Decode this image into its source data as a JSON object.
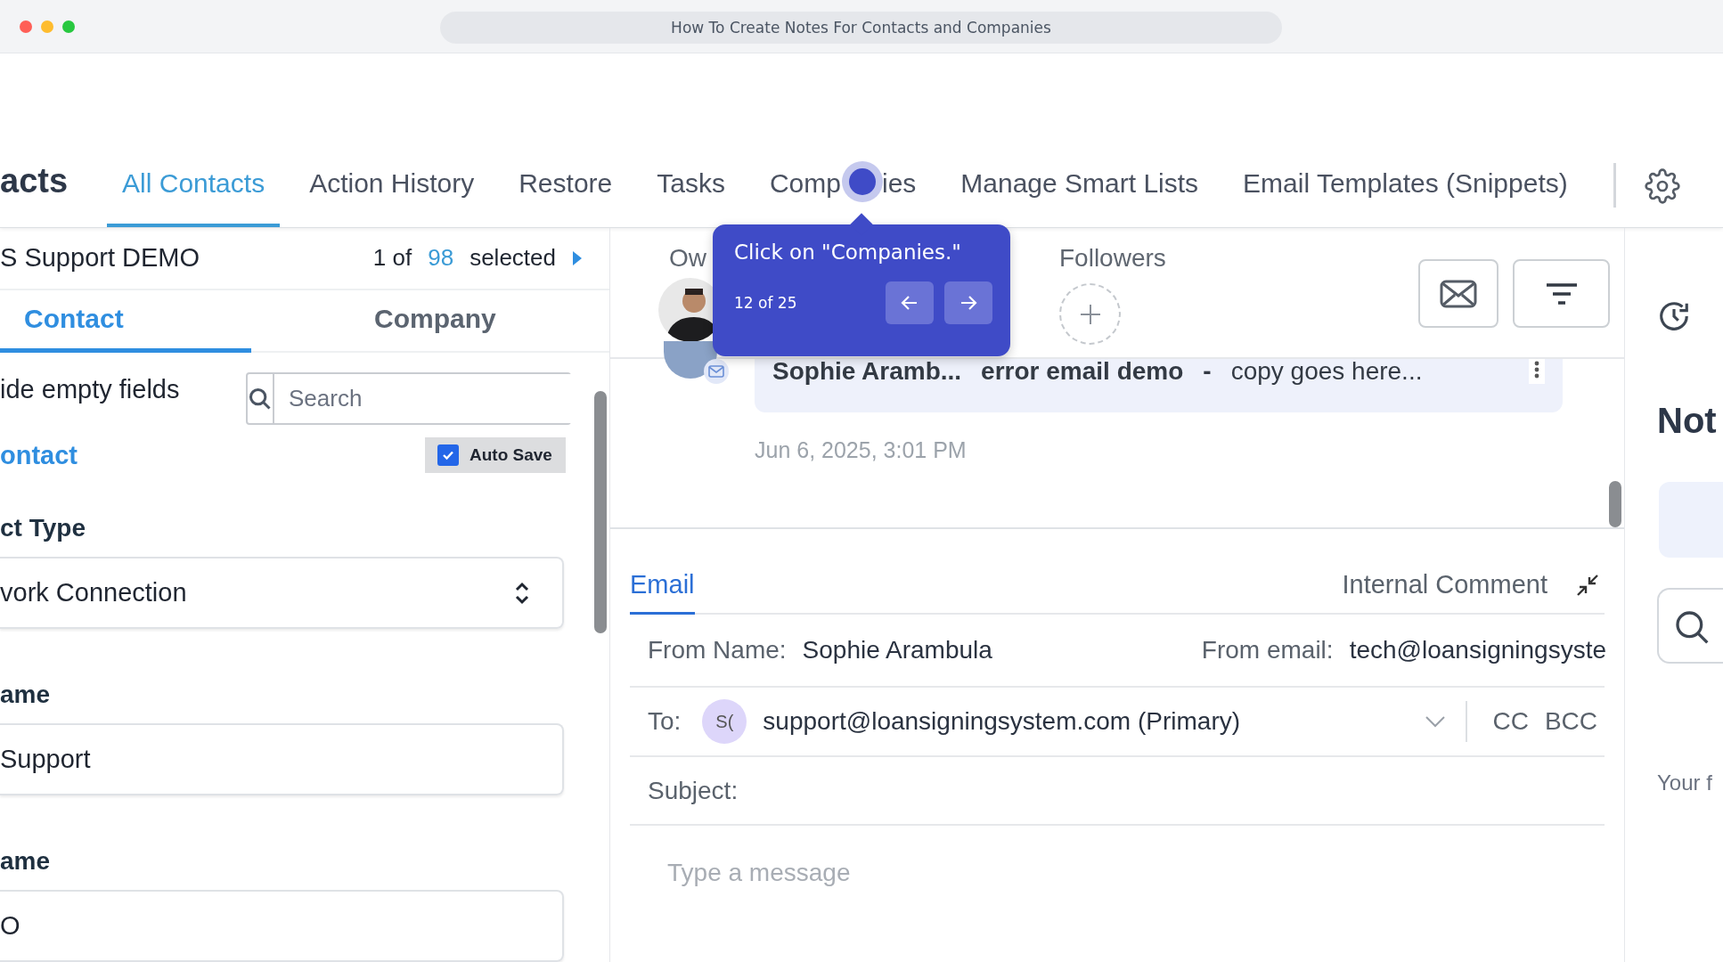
{
  "browser": {
    "title": "How To Create Notes For Contacts and Companies"
  },
  "nav": {
    "section_title": "acts",
    "tabs": [
      {
        "label": "All Contacts",
        "selected": true
      },
      {
        "label": "Action History",
        "selected": false
      },
      {
        "label": "Restore",
        "selected": false
      },
      {
        "label": "Tasks",
        "selected": false
      },
      {
        "label": "Comp",
        "label_end": "ies",
        "selected": false
      },
      {
        "label": "Manage Smart Lists",
        "selected": false
      },
      {
        "label": "Email Templates (Snippets)",
        "selected": false
      }
    ]
  },
  "tooltip": {
    "text": "Click on \"Companies.\"",
    "step": "12 of 25"
  },
  "left": {
    "record_title": "S Support DEMO",
    "pager": {
      "prefix": "1 of",
      "count": "98",
      "suffix": "selected"
    },
    "tabs": [
      {
        "label": "Contact",
        "selected": true
      },
      {
        "label": "Company",
        "selected": false
      }
    ],
    "hide_empty_label": "ide empty fields",
    "search": {
      "placeholder": "Search"
    },
    "section_link": "ontact",
    "auto_save": {
      "label": "Auto Save",
      "checked": true
    },
    "fields": [
      {
        "label": "ct Type",
        "value": "vork Connection",
        "kind": "select"
      },
      {
        "label": "ame",
        "value": "Support",
        "kind": "text"
      },
      {
        "label": "ame",
        "value": "O",
        "kind": "text"
      }
    ]
  },
  "activity": {
    "owner_label": "Ow",
    "followers_label": "Followers",
    "message": {
      "sender": "Sophie Aramb...",
      "subject": "error email demo",
      "separator": "-",
      "preview": "copy goes here...",
      "date": "Jun 6, 2025, 3:01 PM"
    }
  },
  "composer": {
    "tabs": [
      {
        "label": "Email",
        "selected": true
      },
      {
        "label": "Internal Comment",
        "selected": false
      }
    ],
    "from_name_label": "From Name:",
    "from_name": "Sophie Arambula",
    "from_email_label": "From email:",
    "from_email": "tech@loansigningsyste",
    "to_label": "To:",
    "to_avatar": "S(",
    "to": "support@loansigningsystem.com (Primary)",
    "cc": "CC",
    "bcc": "BCC",
    "subject_label": "Subject:",
    "message": {
      "placeholder": "Type a message"
    }
  },
  "notes_panel": {
    "title": "Not",
    "hint": "Your f"
  }
}
